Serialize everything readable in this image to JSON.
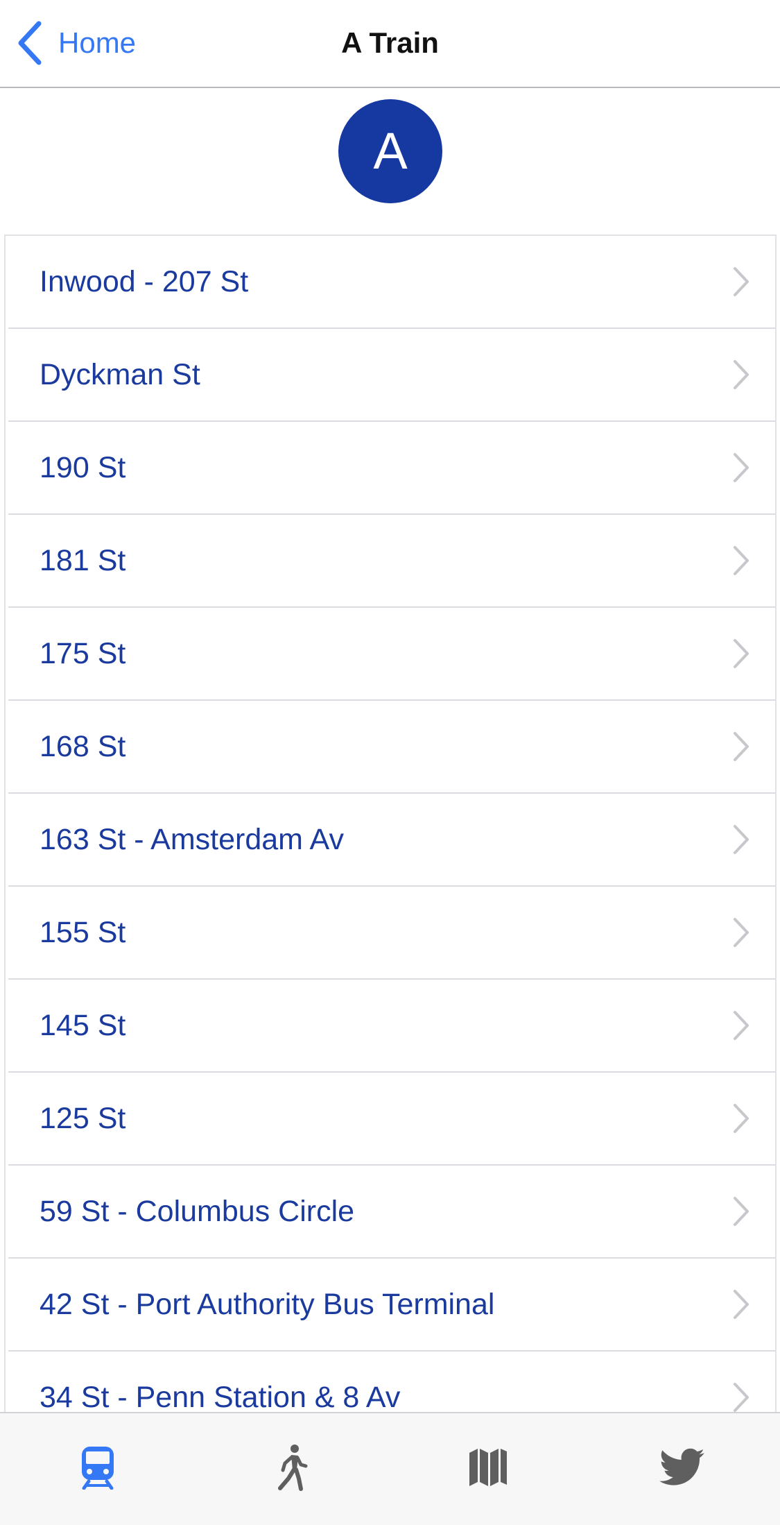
{
  "navbar": {
    "back_label": "Home",
    "title": "A Train"
  },
  "badge": {
    "letter": "A",
    "color": "#1539a0"
  },
  "stations": [
    "Inwood - 207 St",
    "Dyckman St",
    "190 St",
    "181 St",
    "175 St",
    "168 St",
    "163 St - Amsterdam Av",
    "155 St",
    "145 St",
    "125 St",
    "59 St - Columbus Circle",
    "42 St - Port Authority Bus Terminal",
    "34 St - Penn Station & 8 Av"
  ],
  "tabbar": {
    "tabs": [
      {
        "icon": "train-icon",
        "active": true
      },
      {
        "icon": "walking-person-icon",
        "active": false
      },
      {
        "icon": "map-icon",
        "active": false
      },
      {
        "icon": "twitter-bird-icon",
        "active": false
      }
    ],
    "active_color": "#3478f6",
    "inactive_color": "#5f5f5f"
  },
  "colors": {
    "accent": "#3478f6",
    "station_text": "#1a3a9e",
    "chevron": "#c7c7cc"
  }
}
